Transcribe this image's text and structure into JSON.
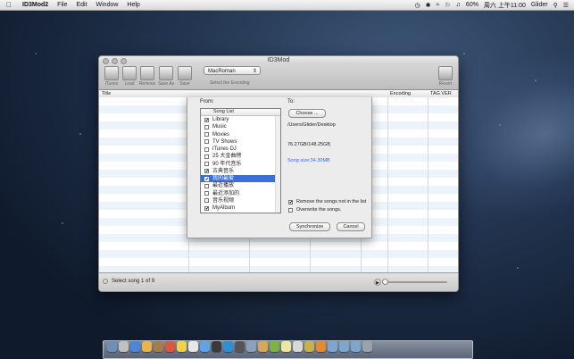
{
  "menubar": {
    "apple_icon": "apple-icon",
    "app_name": "ID3Mod2",
    "menus": [
      "File",
      "Edit",
      "Window",
      "Help"
    ],
    "battery": "60%",
    "clock": "周六 上午11:00",
    "user": "Glider"
  },
  "window": {
    "title": "ID3Mod",
    "toolbar": {
      "buttons": [
        "iTunes",
        "Load",
        "Remove",
        "Save As",
        "Save"
      ],
      "encoding_value": "MacRoman",
      "encoding_label": "Select the Encoding",
      "revert_label": "Revert"
    },
    "columns": [
      "Title",
      "Encoding",
      "TAG VER"
    ],
    "status": "Select song 1 of 9"
  },
  "sheet": {
    "from_label": "From:",
    "to_label": "To:",
    "list_header": "Song List",
    "songs": [
      {
        "name": "Library",
        "checked": "✔"
      },
      {
        "name": "Music",
        "checked": ""
      },
      {
        "name": "Movies",
        "checked": ""
      },
      {
        "name": "TV Shows",
        "checked": ""
      },
      {
        "name": "iTunes DJ",
        "checked": ""
      },
      {
        "name": "25 大金曲榜",
        "checked": ""
      },
      {
        "name": "90 年代音乐",
        "checked": ""
      },
      {
        "name": "古典音乐",
        "checked": "✔"
      },
      {
        "name": "我的最爱",
        "checked": "✔"
      },
      {
        "name": "最近播放",
        "checked": ""
      },
      {
        "name": "最近添加的",
        "checked": ""
      },
      {
        "name": "音乐视频",
        "checked": ""
      },
      {
        "name": "MyAlbum",
        "checked": "✔"
      }
    ],
    "choose_button": "Choose ...",
    "path": "/Users/Glider/Desktop",
    "capacity": "76.27GB/148.25GB",
    "song_size": "Song size:34.30MB",
    "option_remove": "Remove the songs not in the list",
    "option_overwrite": "Overwrite the songs.",
    "option_remove_checked": "✔",
    "option_overwrite_checked": "",
    "sync_button": "Synchronize",
    "cancel_button": "Cancel"
  },
  "colors": {
    "selection": "#3a6fd8",
    "size_text": "#2f6be0"
  }
}
